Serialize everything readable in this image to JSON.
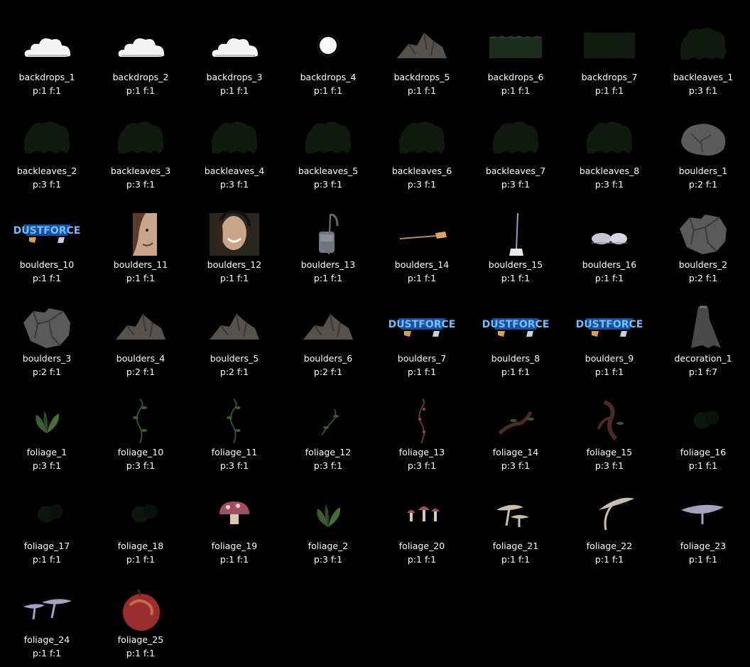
{
  "sprites": [
    {
      "name": "backdrops_1",
      "meta": "p:1 f:1",
      "icon": "cloud"
    },
    {
      "name": "backdrops_2",
      "meta": "p:1 f:1",
      "icon": "cloud"
    },
    {
      "name": "backdrops_3",
      "meta": "p:1 f:1",
      "icon": "cloud"
    },
    {
      "name": "backdrops_4",
      "meta": "p:1 f:1",
      "icon": "moon"
    },
    {
      "name": "backdrops_5",
      "meta": "p:1 f:1",
      "icon": "rock-pile"
    },
    {
      "name": "backdrops_6",
      "meta": "p:1 f:1",
      "icon": "hedge-strip"
    },
    {
      "name": "backdrops_7",
      "meta": "p:1 f:1",
      "icon": "dark-rect"
    },
    {
      "name": "backleaves_1",
      "meta": "p:3 f:1",
      "icon": "leaf-clump"
    },
    {
      "name": "backleaves_2",
      "meta": "p:3 f:1",
      "icon": "leaf-clump"
    },
    {
      "name": "backleaves_3",
      "meta": "p:3 f:1",
      "icon": "leaf-clump"
    },
    {
      "name": "backleaves_4",
      "meta": "p:3 f:1",
      "icon": "leaf-clump"
    },
    {
      "name": "backleaves_5",
      "meta": "p:3 f:1",
      "icon": "leaf-clump"
    },
    {
      "name": "backleaves_6",
      "meta": "p:3 f:1",
      "icon": "leaf-clump"
    },
    {
      "name": "backleaves_7",
      "meta": "p:3 f:1",
      "icon": "leaf-clump"
    },
    {
      "name": "backleaves_8",
      "meta": "p:3 f:1",
      "icon": "leaf-clump"
    },
    {
      "name": "boulders_1",
      "meta": "p:2 f:1",
      "icon": "boulder"
    },
    {
      "name": "boulders_10",
      "meta": "p:1 f:1",
      "icon": "dustforce-logo"
    },
    {
      "name": "boulders_11",
      "meta": "p:1 f:1",
      "icon": "face-photo"
    },
    {
      "name": "boulders_12",
      "meta": "p:1 f:1",
      "icon": "face-headphones"
    },
    {
      "name": "boulders_13",
      "meta": "p:1 f:1",
      "icon": "vacuum"
    },
    {
      "name": "boulders_14",
      "meta": "p:1 f:1",
      "icon": "broom-horizontal"
    },
    {
      "name": "boulders_15",
      "meta": "p:1 f:1",
      "icon": "broom-vertical"
    },
    {
      "name": "boulders_16",
      "meta": "p:1 f:1",
      "icon": "dust-bunnies"
    },
    {
      "name": "boulders_2",
      "meta": "p:2 f:1",
      "icon": "boulder-stack"
    },
    {
      "name": "boulders_3",
      "meta": "p:2 f:1",
      "icon": "boulder-stack"
    },
    {
      "name": "boulders_4",
      "meta": "p:2 f:1",
      "icon": "rock-pile"
    },
    {
      "name": "boulders_5",
      "meta": "p:2 f:1",
      "icon": "rock-pile"
    },
    {
      "name": "boulders_6",
      "meta": "p:2 f:1",
      "icon": "rock-pile"
    },
    {
      "name": "boulders_7",
      "meta": "p:1 f:1",
      "icon": "dustforce-logo"
    },
    {
      "name": "boulders_8",
      "meta": "p:1 f:1",
      "icon": "dustforce-logo"
    },
    {
      "name": "boulders_9",
      "meta": "p:1 f:1",
      "icon": "dustforce-logo"
    },
    {
      "name": "decoration_1",
      "meta": "p:1 f:7",
      "icon": "cape"
    },
    {
      "name": "foliage_1",
      "meta": "p:3 f:1",
      "icon": "leaf-sprout"
    },
    {
      "name": "foliage_10",
      "meta": "p:3 f:1",
      "icon": "vine"
    },
    {
      "name": "foliage_11",
      "meta": "p:3 f:1",
      "icon": "vine"
    },
    {
      "name": "foliage_12",
      "meta": "p:3 f:1",
      "icon": "vine-small"
    },
    {
      "name": "foliage_13",
      "meta": "p:3 f:1",
      "icon": "vine-thorny"
    },
    {
      "name": "foliage_14",
      "meta": "p:3 f:1",
      "icon": "branch"
    },
    {
      "name": "foliage_15",
      "meta": "p:3 f:1",
      "icon": "twisted-branch"
    },
    {
      "name": "foliage_16",
      "meta": "p:1 f:1",
      "icon": "dark-blob"
    },
    {
      "name": "foliage_17",
      "meta": "p:1 f:1",
      "icon": "dark-blob"
    },
    {
      "name": "foliage_18",
      "meta": "p:1 f:1",
      "icon": "dark-blob"
    },
    {
      "name": "foliage_19",
      "meta": "p:1 f:1",
      "icon": "mushroom-red"
    },
    {
      "name": "foliage_2",
      "meta": "p:3 f:1",
      "icon": "leaf-sprout"
    },
    {
      "name": "foliage_20",
      "meta": "p:1 f:1",
      "icon": "mushrooms-small"
    },
    {
      "name": "foliage_21",
      "meta": "p:1 f:1",
      "icon": "mushrooms-tan"
    },
    {
      "name": "foliage_22",
      "meta": "p:1 f:1",
      "icon": "mushroom-tall"
    },
    {
      "name": "foliage_23",
      "meta": "p:1 f:1",
      "icon": "mushroom-purple"
    },
    {
      "name": "foliage_24",
      "meta": "p:1 f:1",
      "icon": "mushrooms-purple"
    },
    {
      "name": "foliage_25",
      "meta": "p:1 f:1",
      "icon": "apple"
    }
  ],
  "colors": {
    "background": "#000000",
    "label": "#ffffff",
    "rock": "#4a4a4a",
    "foliage_dark": "#0f1a10",
    "leaf_green": "#3a5a30",
    "dustforce_blue": "#2a7fd8"
  }
}
